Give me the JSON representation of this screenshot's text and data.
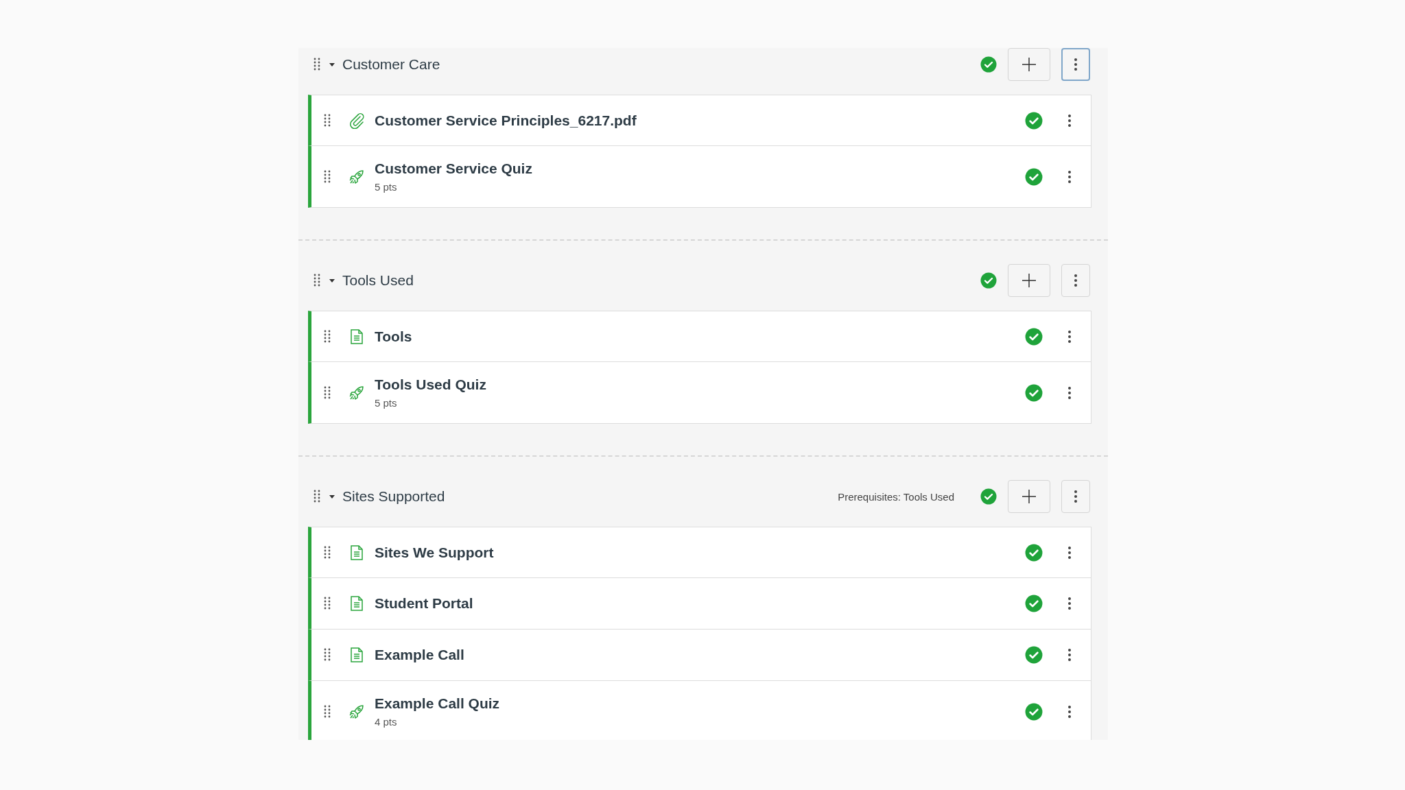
{
  "modules": [
    {
      "title": "Customer Care",
      "expanded": true,
      "published": true,
      "menu_focused": true,
      "items": [
        {
          "kind": "attachment",
          "title": "Customer Service Principles_6217.pdf",
          "published": true
        },
        {
          "kind": "quiz",
          "title": "Customer Service Quiz",
          "points": "5 pts",
          "published": true
        }
      ]
    },
    {
      "title": "Tools Used",
      "expanded": true,
      "published": true,
      "menu_focused": false,
      "items": [
        {
          "kind": "page",
          "title": "Tools",
          "published": true
        },
        {
          "kind": "quiz",
          "title": "Tools Used Quiz",
          "points": "5 pts",
          "published": true
        }
      ]
    },
    {
      "title": "Sites Supported",
      "expanded": true,
      "published": true,
      "menu_focused": false,
      "prerequisites": "Prerequisites: Tools Used",
      "items": [
        {
          "kind": "page",
          "title": "Sites We Support",
          "published": true
        },
        {
          "kind": "page",
          "title": "Student Portal",
          "published": true
        },
        {
          "kind": "page",
          "title": "Example Call",
          "published": true
        },
        {
          "kind": "quiz",
          "title": "Example Call Quiz",
          "points": "4 pts",
          "published": true
        }
      ]
    }
  ]
}
